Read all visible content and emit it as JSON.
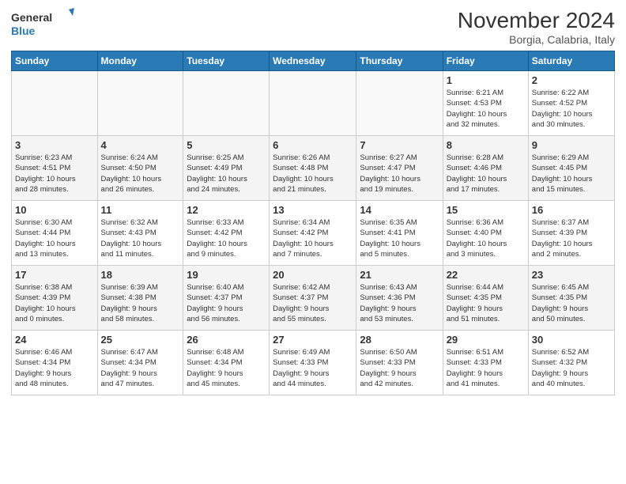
{
  "logo": {
    "line1": "General",
    "line2": "Blue"
  },
  "title": "November 2024",
  "subtitle": "Borgia, Calabria, Italy",
  "days_of_week": [
    "Sunday",
    "Monday",
    "Tuesday",
    "Wednesday",
    "Thursday",
    "Friday",
    "Saturday"
  ],
  "weeks": [
    [
      {
        "day": "",
        "info": ""
      },
      {
        "day": "",
        "info": ""
      },
      {
        "day": "",
        "info": ""
      },
      {
        "day": "",
        "info": ""
      },
      {
        "day": "",
        "info": ""
      },
      {
        "day": "1",
        "info": "Sunrise: 6:21 AM\nSunset: 4:53 PM\nDaylight: 10 hours\nand 32 minutes."
      },
      {
        "day": "2",
        "info": "Sunrise: 6:22 AM\nSunset: 4:52 PM\nDaylight: 10 hours\nand 30 minutes."
      }
    ],
    [
      {
        "day": "3",
        "info": "Sunrise: 6:23 AM\nSunset: 4:51 PM\nDaylight: 10 hours\nand 28 minutes."
      },
      {
        "day": "4",
        "info": "Sunrise: 6:24 AM\nSunset: 4:50 PM\nDaylight: 10 hours\nand 26 minutes."
      },
      {
        "day": "5",
        "info": "Sunrise: 6:25 AM\nSunset: 4:49 PM\nDaylight: 10 hours\nand 24 minutes."
      },
      {
        "day": "6",
        "info": "Sunrise: 6:26 AM\nSunset: 4:48 PM\nDaylight: 10 hours\nand 21 minutes."
      },
      {
        "day": "7",
        "info": "Sunrise: 6:27 AM\nSunset: 4:47 PM\nDaylight: 10 hours\nand 19 minutes."
      },
      {
        "day": "8",
        "info": "Sunrise: 6:28 AM\nSunset: 4:46 PM\nDaylight: 10 hours\nand 17 minutes."
      },
      {
        "day": "9",
        "info": "Sunrise: 6:29 AM\nSunset: 4:45 PM\nDaylight: 10 hours\nand 15 minutes."
      }
    ],
    [
      {
        "day": "10",
        "info": "Sunrise: 6:30 AM\nSunset: 4:44 PM\nDaylight: 10 hours\nand 13 minutes."
      },
      {
        "day": "11",
        "info": "Sunrise: 6:32 AM\nSunset: 4:43 PM\nDaylight: 10 hours\nand 11 minutes."
      },
      {
        "day": "12",
        "info": "Sunrise: 6:33 AM\nSunset: 4:42 PM\nDaylight: 10 hours\nand 9 minutes."
      },
      {
        "day": "13",
        "info": "Sunrise: 6:34 AM\nSunset: 4:42 PM\nDaylight: 10 hours\nand 7 minutes."
      },
      {
        "day": "14",
        "info": "Sunrise: 6:35 AM\nSunset: 4:41 PM\nDaylight: 10 hours\nand 5 minutes."
      },
      {
        "day": "15",
        "info": "Sunrise: 6:36 AM\nSunset: 4:40 PM\nDaylight: 10 hours\nand 3 minutes."
      },
      {
        "day": "16",
        "info": "Sunrise: 6:37 AM\nSunset: 4:39 PM\nDaylight: 10 hours\nand 2 minutes."
      }
    ],
    [
      {
        "day": "17",
        "info": "Sunrise: 6:38 AM\nSunset: 4:39 PM\nDaylight: 10 hours\nand 0 minutes."
      },
      {
        "day": "18",
        "info": "Sunrise: 6:39 AM\nSunset: 4:38 PM\nDaylight: 9 hours\nand 58 minutes."
      },
      {
        "day": "19",
        "info": "Sunrise: 6:40 AM\nSunset: 4:37 PM\nDaylight: 9 hours\nand 56 minutes."
      },
      {
        "day": "20",
        "info": "Sunrise: 6:42 AM\nSunset: 4:37 PM\nDaylight: 9 hours\nand 55 minutes."
      },
      {
        "day": "21",
        "info": "Sunrise: 6:43 AM\nSunset: 4:36 PM\nDaylight: 9 hours\nand 53 minutes."
      },
      {
        "day": "22",
        "info": "Sunrise: 6:44 AM\nSunset: 4:35 PM\nDaylight: 9 hours\nand 51 minutes."
      },
      {
        "day": "23",
        "info": "Sunrise: 6:45 AM\nSunset: 4:35 PM\nDaylight: 9 hours\nand 50 minutes."
      }
    ],
    [
      {
        "day": "24",
        "info": "Sunrise: 6:46 AM\nSunset: 4:34 PM\nDaylight: 9 hours\nand 48 minutes."
      },
      {
        "day": "25",
        "info": "Sunrise: 6:47 AM\nSunset: 4:34 PM\nDaylight: 9 hours\nand 47 minutes."
      },
      {
        "day": "26",
        "info": "Sunrise: 6:48 AM\nSunset: 4:34 PM\nDaylight: 9 hours\nand 45 minutes."
      },
      {
        "day": "27",
        "info": "Sunrise: 6:49 AM\nSunset: 4:33 PM\nDaylight: 9 hours\nand 44 minutes."
      },
      {
        "day": "28",
        "info": "Sunrise: 6:50 AM\nSunset: 4:33 PM\nDaylight: 9 hours\nand 42 minutes."
      },
      {
        "day": "29",
        "info": "Sunrise: 6:51 AM\nSunset: 4:33 PM\nDaylight: 9 hours\nand 41 minutes."
      },
      {
        "day": "30",
        "info": "Sunrise: 6:52 AM\nSunset: 4:32 PM\nDaylight: 9 hours\nand 40 minutes."
      }
    ]
  ]
}
